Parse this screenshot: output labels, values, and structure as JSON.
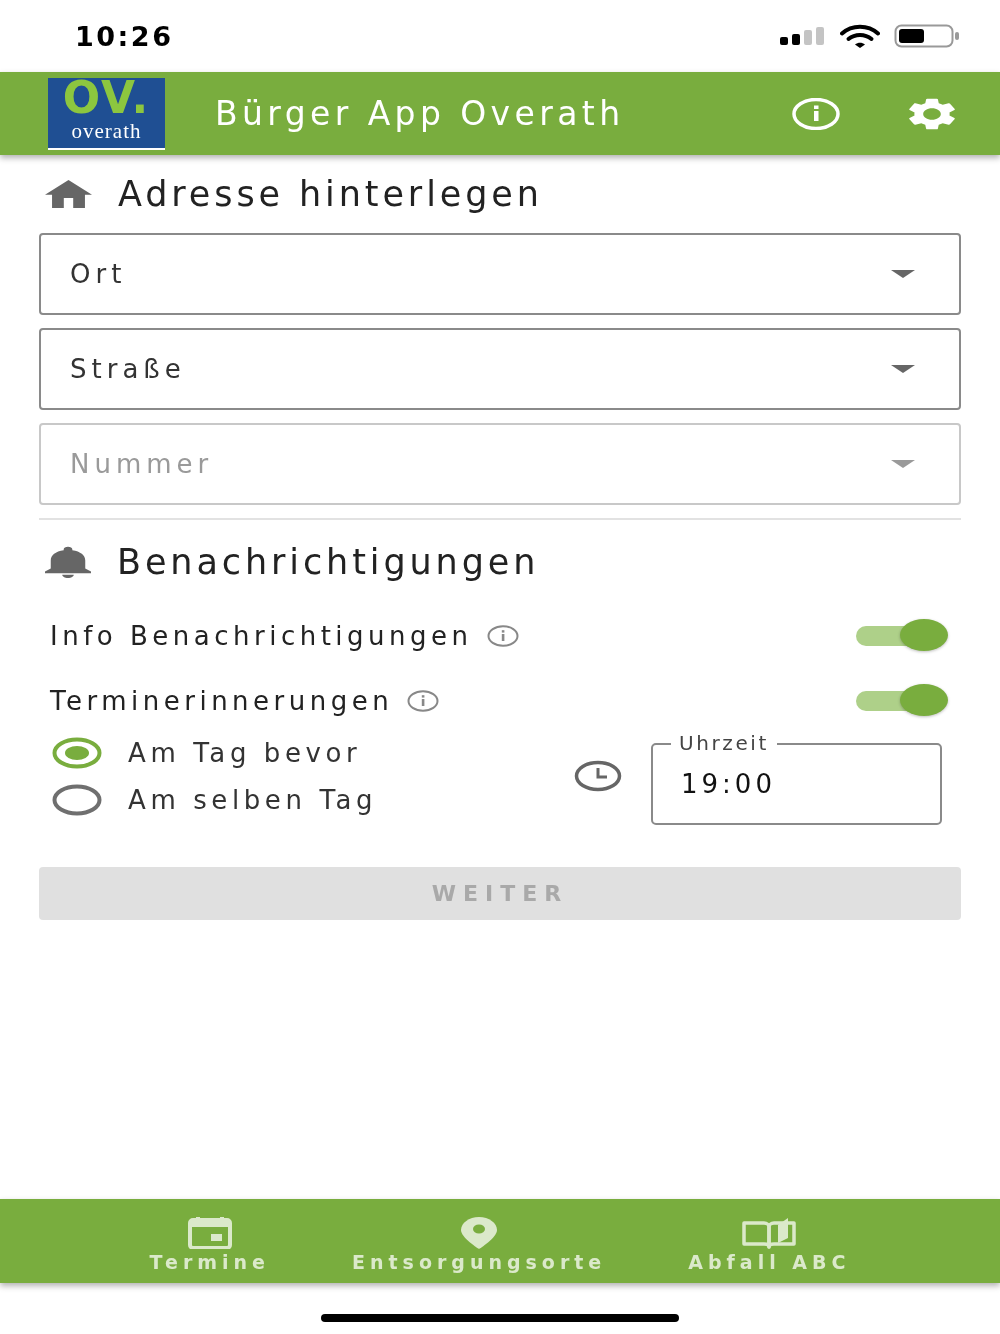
{
  "status_bar": {
    "time": "10:26"
  },
  "header": {
    "logo_mark": "OV.",
    "logo_text": "overath",
    "title": "Bürger App Overath"
  },
  "address": {
    "title": "Adresse hinterlegen",
    "selects": [
      {
        "label": "Ort",
        "disabled": false
      },
      {
        "label": "Straße",
        "disabled": false
      },
      {
        "label": "Nummer",
        "disabled": true
      }
    ]
  },
  "notifications": {
    "title": "Benachrichtigungen",
    "settings": [
      {
        "label": "Info Benachrichtigungen",
        "on": true
      },
      {
        "label": "Terminerinnerungen",
        "on": true
      }
    ],
    "reminder_options": [
      {
        "label": "Am Tag bevor",
        "selected": true
      },
      {
        "label": "Am selben Tag",
        "selected": false
      }
    ],
    "time_field": {
      "label": "Uhrzeit",
      "value": "19:00"
    }
  },
  "next_button": {
    "label": "WEITER",
    "disabled": true
  },
  "bottom_nav": [
    {
      "label": "Termine",
      "kind": "calendar"
    },
    {
      "label": "Entsorgungsorte",
      "kind": "pin"
    },
    {
      "label": "Abfall ABC",
      "kind": "book"
    }
  ]
}
